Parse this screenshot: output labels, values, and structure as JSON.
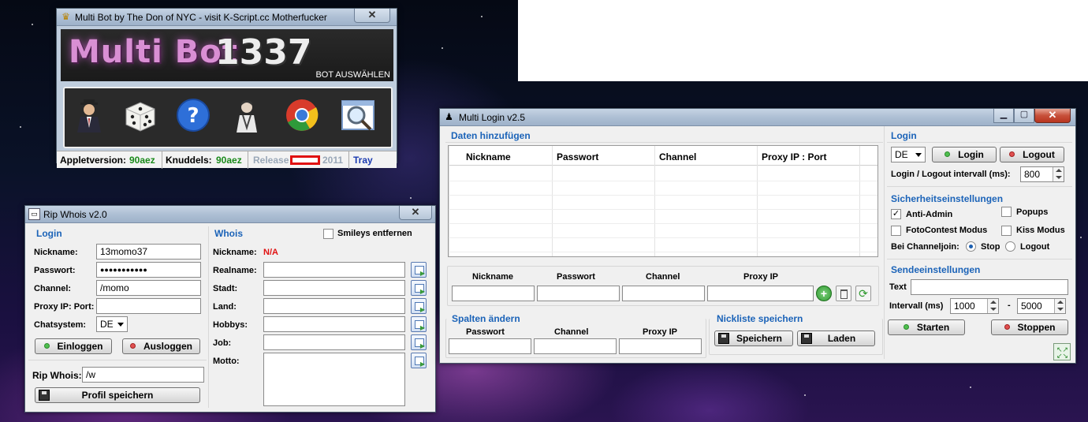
{
  "multibot": {
    "title": "Multi Bot by The Don of NYC - visit K-Script.cc Motherfucker",
    "close": "✕",
    "banner_title": "Multi Bot",
    "banner_number": "1337",
    "bot_select": "BOT AUSWÄHLEN",
    "icons": [
      "agent-icon",
      "dice-icon",
      "help-icon",
      "person-icon",
      "chrome-icon",
      "search-window-icon"
    ],
    "status": {
      "applet_label": "Appletversion:",
      "applet_value": "90aez",
      "knuddels_label": "Knuddels:",
      "knuddels_value": "90aez",
      "release_label": "Release",
      "release_year": "2011",
      "tray": "Tray"
    },
    "colors": {
      "version_green": "#1a8a1a",
      "tray_blue": "#1a3ab0",
      "release_grey": "#9aa8b8"
    }
  },
  "ripwhois": {
    "title": "Rip Whois v2.0",
    "close": "✕",
    "login": {
      "header": "Login",
      "nickname_label": "Nickname:",
      "nickname_value": "13momo37",
      "password_label": "Passwort:",
      "password_value": "●●●●●●●●●●●",
      "channel_label": "Channel:",
      "channel_value": "/momo",
      "proxy_label": "Proxy IP: Port:",
      "proxy_value": "",
      "chatsystem_label": "Chatsystem:",
      "chatsystem_value": "DE",
      "einloggen": "Einloggen",
      "ausloggen": "Ausloggen"
    },
    "rip": {
      "label": "Rip Whois:",
      "value": "/w",
      "save": "Profil speichern"
    },
    "whois": {
      "header": "Whois",
      "smileys": "Smileys entfernen",
      "nickname_label": "Nickname:",
      "nickname_value": "N/A",
      "realname_label": "Realname:",
      "stadt_label": "Stadt:",
      "land_label": "Land:",
      "hobbys_label": "Hobbys:",
      "job_label": "Job:",
      "motto_label": "Motto:"
    }
  },
  "multilogin": {
    "title": "Multi Login v2.5",
    "minimize": "▁",
    "maximize": "▢",
    "close": "✕",
    "daten": {
      "header": "Daten hinzufügen",
      "columns": [
        "Nickname",
        "Passwort",
        "Channel",
        "Proxy IP : Port"
      ],
      "input_labels": [
        "Nickname",
        "Passwort",
        "Channel",
        "Proxy IP"
      ]
    },
    "spalten": {
      "header": "Spalten ändern",
      "labels": [
        "Passwort",
        "Channel",
        "Proxy IP"
      ]
    },
    "nickliste": {
      "header": "Nickliste speichern",
      "save": "Speichern",
      "load": "Laden"
    },
    "login": {
      "header": "Login",
      "lang": "DE",
      "login_btn": "Login",
      "logout_btn": "Logout",
      "interval_label": "Login / Logout intervall (ms):",
      "interval_value": "800"
    },
    "sicherheit": {
      "header": "Sicherheitseinstellungen",
      "anti_admin": "Anti-Admin",
      "popups": "Popups",
      "fotocontest": "FotoContest Modus",
      "kiss": "Kiss Modus",
      "channeljoin_label": "Bei Channeljoin:",
      "stop": "Stop",
      "logout": "Logout"
    },
    "sende": {
      "header": "Sendeeinstellungen",
      "text_label": "Text",
      "text_value": "",
      "interval_label": "Intervall (ms)",
      "interval_from": "1000",
      "dash": "-",
      "interval_to": "5000",
      "start": "Starten",
      "stop": "Stoppen"
    }
  }
}
